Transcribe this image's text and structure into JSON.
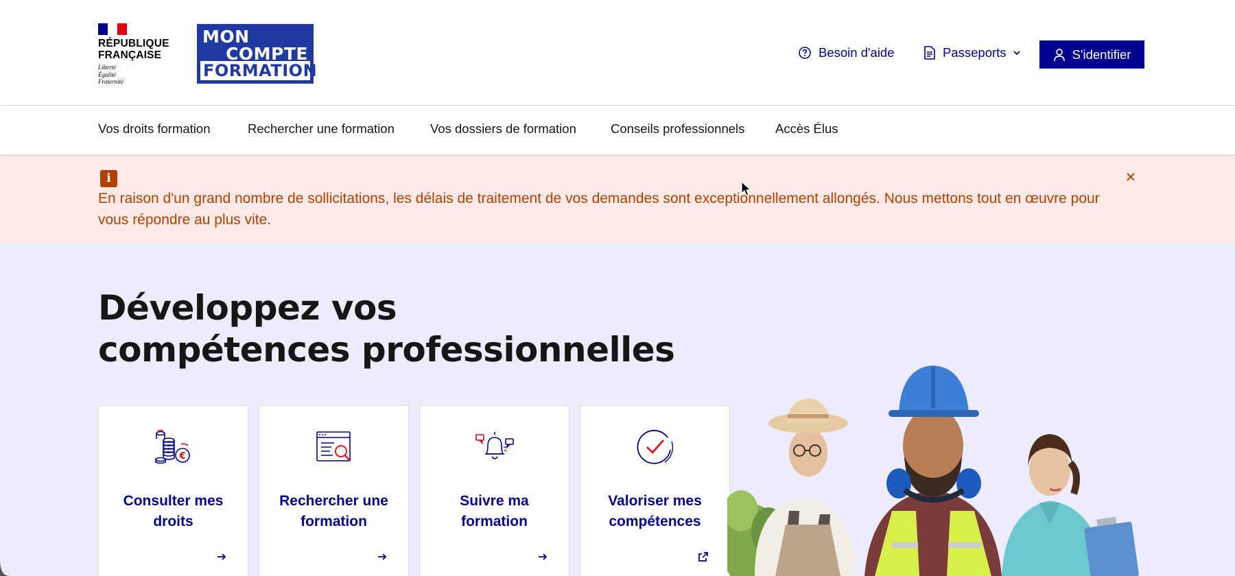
{
  "header": {
    "gov_logo": {
      "line1": "RÉPUBLIQUE",
      "line2": "FRANÇAISE",
      "motto1": "Liberté",
      "motto2": "Égalité",
      "motto3": "Fraternité"
    },
    "site_logo": {
      "line1": "MON",
      "line2": "COMPTE",
      "line3": "FORMATION"
    },
    "help_label": "Besoin d'aide",
    "passports_label": "Passeports",
    "login_label": "S'identifier"
  },
  "nav": {
    "items": [
      {
        "label": "Vos droits formation"
      },
      {
        "label": "Rechercher une formation"
      },
      {
        "label": "Vos dossiers de formation"
      },
      {
        "label": "Conseils professionnels"
      },
      {
        "label": "Accès Élus"
      }
    ]
  },
  "alert": {
    "icon": "info-icon",
    "text": "En raison d'un grand nombre de sollicitations, les délais de traitement de vos demandes sont exceptionnellement allongés. Nous mettons tout en œuvre pour vous répondre au plus vite.",
    "close_icon": "close-icon"
  },
  "hero": {
    "title_line1": "Développez vos",
    "title_line2": "compétences professionnelles",
    "cards": [
      {
        "line1": "Consulter mes",
        "line2": "droits",
        "icon": "coins-euro-icon",
        "arrow": "arrow-right-icon"
      },
      {
        "line1": "Rechercher une",
        "line2": "formation",
        "icon": "browser-search-icon",
        "arrow": "arrow-right-icon"
      },
      {
        "line1": "Suivre ma",
        "line2": "formation",
        "icon": "bell-notification-icon",
        "arrow": "arrow-right-icon"
      },
      {
        "line1": "Valoriser mes",
        "line2": "compétences",
        "icon": "check-circle-icon",
        "arrow": "external-link-icon"
      }
    ]
  },
  "colors": {
    "primary_blue": "#000091",
    "alert_bg": "#fde9e6",
    "alert_text": "#b34000",
    "hero_bg": "#ececfc",
    "flag_blue": "#000091",
    "flag_red": "#e1000f"
  }
}
